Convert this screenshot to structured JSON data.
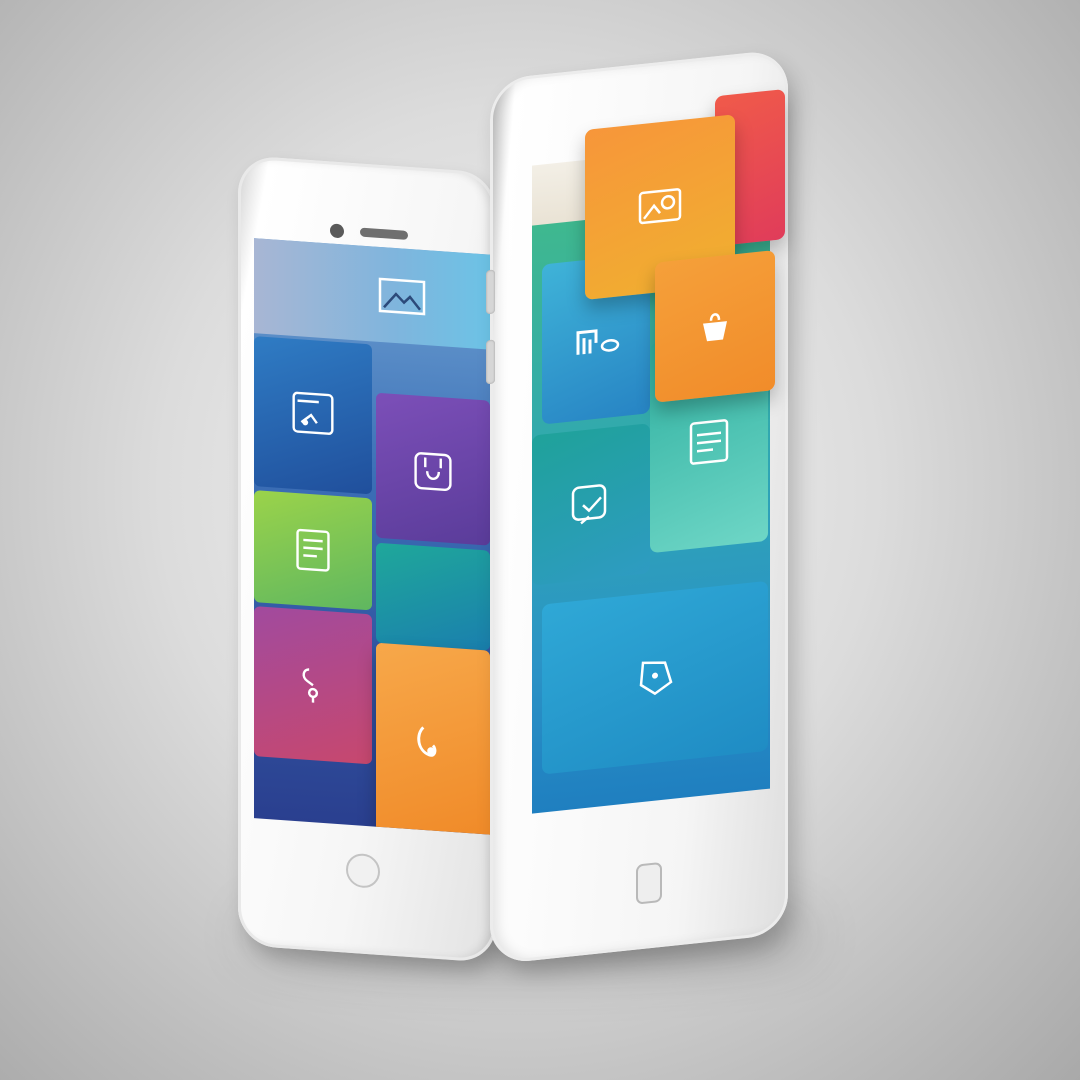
{
  "scene": {
    "description_colors": {
      "background_center": "#f4f4f4",
      "background_edge": "#a9a9a9",
      "phone_body": "#f6f6f6"
    }
  },
  "left_phone": {
    "tiles": [
      {
        "name": "tile-document-icon",
        "icon": "document-hand-icon",
        "color": "#2f6db3"
      },
      {
        "name": "tile-bag-icon",
        "icon": "shopping-bag-icon",
        "color": "#6a45a8"
      },
      {
        "name": "tile-notes-icon",
        "icon": "notes-list-icon",
        "color": "#8cc63f"
      },
      {
        "name": "tile-teal",
        "icon": "",
        "color": "#1aa3a0"
      },
      {
        "name": "tile-music-icon",
        "icon": "music-note-icon",
        "color": "#b34a9a"
      },
      {
        "name": "tile-headphones-icon",
        "icon": "headphones-icon",
        "color": "#f2a23a"
      }
    ]
  },
  "right_phone": {
    "tiles": [
      {
        "name": "tile-photo-icon",
        "icon": "photo-icon",
        "color": "#f59a2f"
      },
      {
        "name": "tile-red",
        "icon": "",
        "color": "#e94c4c"
      },
      {
        "name": "tile-bag-icon",
        "icon": "bag-icon",
        "color": "#f5a03a"
      },
      {
        "name": "tile-camera-icon",
        "icon": "camera-hand-icon",
        "color": "#2aa0d0"
      },
      {
        "name": "tile-chat-icon",
        "icon": "chat-lines-icon",
        "color": "#36b89b"
      },
      {
        "name": "tile-share-icon",
        "icon": "share-icon",
        "color": "#27a8b8"
      },
      {
        "name": "tile-tag-icon",
        "icon": "tag-icon",
        "color": "#2f9bd4"
      }
    ]
  }
}
